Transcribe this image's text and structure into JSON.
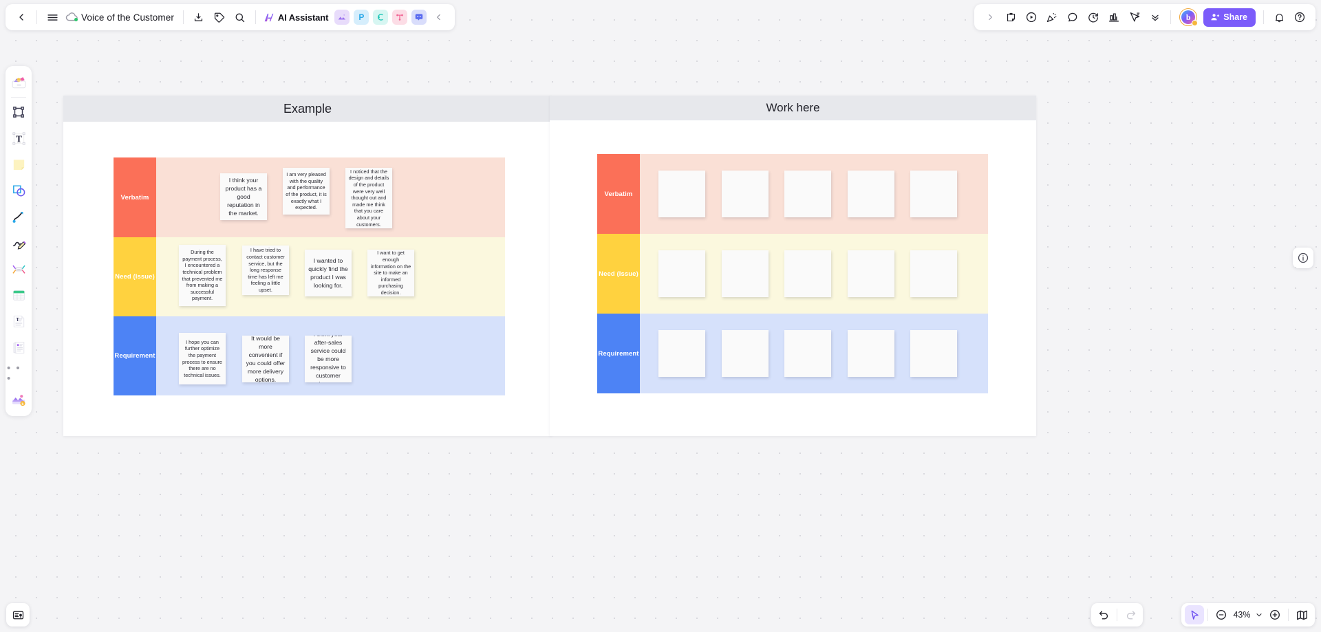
{
  "topbar": {
    "back_label": "back",
    "menu_label": "menu",
    "doc_title": "Voice of the Customer",
    "download_label": "download",
    "tag_label": "tag",
    "search_label": "search",
    "ai_assistant_label": "AI Assistant",
    "app_chips": [
      {
        "name": "image-app",
        "glyph": "",
        "bg": "#e8dcfb",
        "fg": "#8b5cf6"
      },
      {
        "name": "presentation-app",
        "glyph": "P",
        "bg": "#d6eefc",
        "fg": "#2aa8e8"
      },
      {
        "name": "mindmap-app",
        "glyph": "",
        "bg": "#d7f6f2",
        "fg": "#22c7b8"
      },
      {
        "name": "flowchart-app",
        "glyph": "",
        "bg": "#fcdde6",
        "fg": "#f06090"
      },
      {
        "name": "comment-app",
        "glyph": "",
        "bg": "#d9ddfb",
        "fg": "#5b6cf0"
      }
    ],
    "collapse_label": "collapse",
    "right_tools": [
      {
        "name": "expand-chevron-icon",
        "label": "expand"
      },
      {
        "name": "sticky-note-icon",
        "label": "Sticky note"
      },
      {
        "name": "play-circle-icon",
        "label": "Present"
      },
      {
        "name": "celebrate-icon",
        "label": "Celebrate"
      },
      {
        "name": "comment-icon",
        "label": "Comment"
      },
      {
        "name": "timer-icon",
        "label": "Timer"
      },
      {
        "name": "vote-chart-icon",
        "label": "Vote"
      },
      {
        "name": "cursor-broadcast-icon",
        "label": "Follow"
      },
      {
        "name": "more-chevrons-icon",
        "label": "More"
      }
    ],
    "share_label": "Share",
    "avatar_initial": "b",
    "notification_label": "notifications",
    "help_label": "help"
  },
  "tool_rail": {
    "items": [
      {
        "name": "assets-library-icon",
        "label": "Assets"
      },
      {
        "name": "frame-icon",
        "label": "Frame"
      },
      {
        "name": "text-icon",
        "label": "Text"
      },
      {
        "name": "sticky-note-icon",
        "label": "Sticky note"
      },
      {
        "name": "shapes-icon",
        "label": "Shapes"
      },
      {
        "name": "connector-icon",
        "label": "Connector"
      },
      {
        "name": "pen-icon",
        "label": "Pen"
      },
      {
        "name": "mindmap-icon",
        "label": "Mind map"
      },
      {
        "name": "table-icon",
        "label": "Table"
      },
      {
        "name": "text-block-icon",
        "label": "Text block"
      },
      {
        "name": "document-icon",
        "label": "Document"
      },
      {
        "name": "more-tools-icon",
        "label": "More"
      },
      {
        "name": "templates-icon",
        "label": "Templates"
      }
    ],
    "more_dots": "• • •"
  },
  "bottom_bar": {
    "ai_tools_label": "AI tools",
    "undo_label": "Undo",
    "redo_label": "Redo",
    "select_label": "Select",
    "zoom_out_label": "Zoom out",
    "zoom_level": "43%",
    "zoom_chevron": "⌄",
    "zoom_in_label": "Zoom in",
    "minimap_label": "Mini map",
    "info_label": "Info"
  },
  "board": {
    "frames": [
      {
        "id": "example",
        "title": "Example",
        "title_size": "18px"
      },
      {
        "id": "work-here",
        "title": "Work here",
        "title_size": "17px"
      }
    ],
    "row_colors": {
      "verbatim": {
        "label_bg": "#fb7058",
        "body_bg": "#fae0d6"
      },
      "need": {
        "label_bg": "#ffd23f",
        "body_bg": "#fbf8de"
      },
      "requirement": {
        "label_bg": "#4d83f5",
        "body_bg": "#d6e1fb"
      }
    },
    "example_matrix": {
      "rows": [
        {
          "key": "verbatim",
          "label": "Verbatim",
          "notes": [
            "I think your product has a good reputation in the market.",
            "I am very pleased with the quality and performance of the product, it is exactly what I expected.",
            "I noticed that the design and details of the product were very well thought out and made me think that you care about your customers."
          ]
        },
        {
          "key": "need",
          "label": "Need (Issue)",
          "notes": [
            "During the payment process, I encountered a technical problem that prevented me from making a successful payment.",
            "I have tried to contact customer service, but the long response time has left me feeling a little upset.",
            "I wanted to quickly find the product I was looking for.",
            "I want to get enough information on the site to make an informed purchasing decision."
          ]
        },
        {
          "key": "requirement",
          "label": "Requirement",
          "notes": [
            "I hope you can further optimize the payment process to ensure there are no technical issues.",
            "It would be more convenient if you could offer more delivery options.",
            "I think your after-sales service could be more responsive to customer issues."
          ]
        }
      ]
    },
    "work_matrix": {
      "rows": [
        {
          "key": "verbatim",
          "label": "Verbatim",
          "empty_notes": 5
        },
        {
          "key": "need",
          "label": "Need (Issue)",
          "empty_notes": 5
        },
        {
          "key": "requirement",
          "label": "Requirement",
          "empty_notes": 5
        }
      ]
    }
  }
}
